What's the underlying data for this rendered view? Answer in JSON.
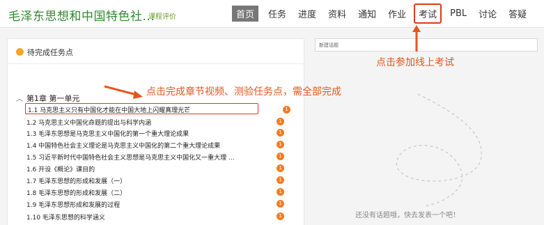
{
  "header": {
    "course_title": "毛泽东思想和中国特色社...",
    "course_eval": "课程评价",
    "nav": [
      "首页",
      "任务",
      "进度",
      "资料",
      "通知",
      "作业",
      "考试",
      "PBL",
      "讨论",
      "答疑"
    ]
  },
  "left_panel": {
    "title": "待完成任务点",
    "chapter": "第1章 第一单元",
    "lessons": [
      {
        "label": "1.1  马克思主义只有中国化才能在中国大地上闪耀真理光芒",
        "badge": "1"
      },
      {
        "label": "1.2  马克思主义中国化命题的提出与科学内涵",
        "badge": "1"
      },
      {
        "label": "1.3  毛泽东思想是马克思主义中国化的第一个重大理论成果",
        "badge": "1"
      },
      {
        "label": "1.4  中国特色社会主义理论是马克思主义中国化的第二个重大理论成果",
        "badge": "1"
      },
      {
        "label": "1.5  习近平新时代中国特色社会主义思想是马克思主义中国化又一重大理 ...",
        "badge": "1"
      },
      {
        "label": "1.6  开设《概论》课目的",
        "badge": "1"
      },
      {
        "label": "1.7  毛泽东思想的形成和发展（一）",
        "badge": "1"
      },
      {
        "label": "1.8  毛泽东思想的形成和发展（二）",
        "badge": "1"
      },
      {
        "label": "1.9  毛泽东思想形成和发展的过程",
        "badge": "1"
      },
      {
        "label": "1.10  毛泽东思想的科学涵义",
        "badge": "1"
      }
    ]
  },
  "right_panel": {
    "new_topic_placeholder": "新建话题",
    "empty_text": "还没有话题哦，快去发表一个吧！"
  },
  "annotations": {
    "exam_hint": "点击参加线上考试",
    "tasks_hint": "点击完成章节视频、测验任务点，需全部完成",
    "color": "#e2571d"
  }
}
